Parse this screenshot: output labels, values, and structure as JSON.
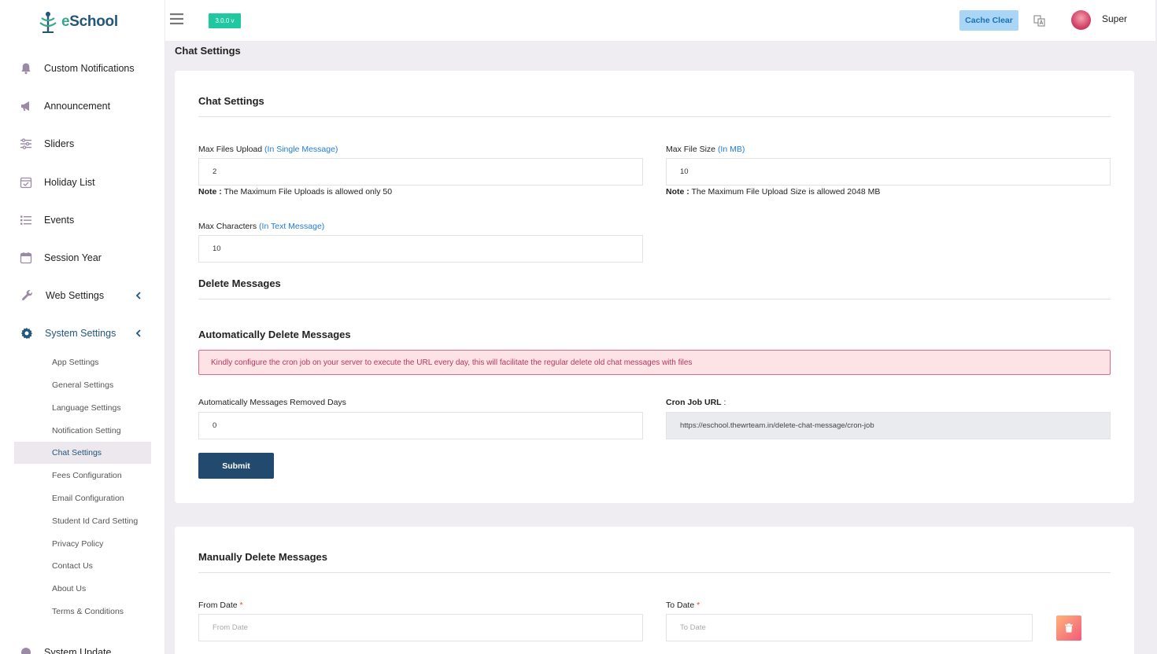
{
  "brand": {
    "name_prefix": "e",
    "name_rest": "School"
  },
  "topbar": {
    "version": "3.0.0 v",
    "cache_clear": "Cache Clear",
    "user_name": "Super"
  },
  "sidebar": {
    "items": [
      {
        "label": "Custom Notifications",
        "icon": "bell-icon"
      },
      {
        "label": "Announcement",
        "icon": "megaphone-icon"
      },
      {
        "label": "Sliders",
        "icon": "sliders-icon"
      },
      {
        "label": "Holiday List",
        "icon": "calendar-check-icon"
      },
      {
        "label": "Events",
        "icon": "list-icon"
      },
      {
        "label": "Session Year",
        "icon": "calendar-icon"
      },
      {
        "label": "Web Settings",
        "icon": "wrench-icon"
      },
      {
        "label": "System Settings",
        "icon": "gear-icon"
      },
      {
        "label": "System Update",
        "icon": "update-icon"
      }
    ],
    "sub_items": [
      "App Settings",
      "General Settings",
      "Language Settings",
      "Notification Setting",
      "Chat Settings",
      "Fees Configuration",
      "Email Configuration",
      "Student Id Card Setting",
      "Privacy Policy",
      "Contact Us",
      "About Us",
      "Terms & Conditions"
    ]
  },
  "page": {
    "title": "Chat Settings"
  },
  "chat_settings": {
    "title": "Chat Settings",
    "max_files_label": "Max Files Upload",
    "max_files_hint": "(In Single Message)",
    "max_files_value": "2",
    "max_files_note_label": "Note :",
    "max_files_note": "The Maximum File Uploads is allowed only 50",
    "max_size_label": "Max File Size",
    "max_size_hint": "(In MB)",
    "max_size_value": "10",
    "max_size_note_label": "Note :",
    "max_size_note": "The Maximum File Upload Size is allowed 2048 MB",
    "max_chars_label": "Max Characters",
    "max_chars_hint": "(In Text Message)",
    "max_chars_value": "10"
  },
  "delete_messages": {
    "title": "Delete Messages",
    "auto_title": "Automatically Delete Messages",
    "alert": "Kindly configure the cron job on your server to execute the URL every day, this will facilitate the regular delete old chat messages with files",
    "removed_days_label": "Automatically Messages Removed Days",
    "removed_days_value": "0",
    "cron_label": "Cron Job URL",
    "cron_colon": " :",
    "cron_url": "https://eschool.thewrteam.in/delete-chat-message/cron-job",
    "submit": "Submit"
  },
  "manual_delete": {
    "title": "Manually Delete Messages",
    "from_label": "From Date",
    "from_placeholder": "From Date",
    "to_label": "To Date",
    "to_placeholder": "To Date",
    "required_mark": "*"
  },
  "colors": {
    "primary": "#22496e",
    "accent": "#1fc8a1",
    "hint": "#1f7bd9",
    "alert_bg": "#fde2e6"
  }
}
